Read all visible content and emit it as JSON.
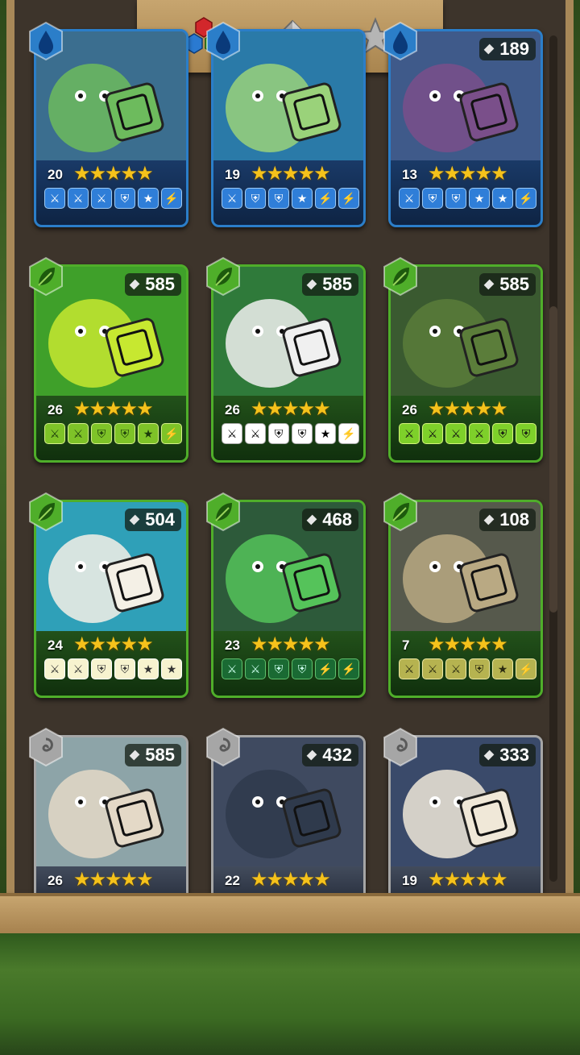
{
  "tabs": [
    {
      "name": "colors-tab",
      "icon": "colored-hexagons-icon",
      "active": true
    },
    {
      "name": "dice-tab",
      "icon": "gray-die-icon",
      "active": false
    },
    {
      "name": "star-tab",
      "icon": "star-icon",
      "active": false
    }
  ],
  "cards": [
    {
      "id": "snake-creature",
      "element": "water",
      "shards": "",
      "level": "20",
      "stars": "★★★★★",
      "faces": [
        "⚔",
        "⚔",
        "⚔",
        "⛨",
        "★",
        "⚡"
      ],
      "theme": "blue"
    },
    {
      "id": "owl-mage",
      "element": "water",
      "shards": "",
      "level": "19",
      "stars": "★★★★★",
      "faces": [
        "⚔",
        "⛨",
        "⛨",
        "★",
        "⚡",
        "⚡"
      ],
      "theme": "blue"
    },
    {
      "id": "medusa",
      "element": "water",
      "shards": "189",
      "level": "13",
      "stars": "★★★★★",
      "faces": [
        "⚔",
        "⛨",
        "⛨",
        "★",
        "★",
        "⚡"
      ],
      "theme": "blue"
    },
    {
      "id": "slime",
      "element": "nature",
      "shards": "585",
      "level": "26",
      "stars": "★★★★★",
      "faces": [
        "⚔",
        "⚔",
        "⛨",
        "⛨",
        "★",
        "⚡"
      ],
      "theme": "green"
    },
    {
      "id": "panda",
      "element": "nature",
      "shards": "585",
      "level": "26",
      "stars": "★★★★★",
      "faces": [
        "⚔",
        "⚔",
        "⛨",
        "⛨",
        "★",
        "⚡"
      ],
      "theme": "green panda"
    },
    {
      "id": "orc",
      "element": "nature",
      "shards": "585",
      "level": "26",
      "stars": "★★★★★",
      "faces": [
        "⚔",
        "⚔",
        "⚔",
        "⚔",
        "⛨",
        "⛨"
      ],
      "theme": "green orc"
    },
    {
      "id": "unicorn",
      "element": "nature",
      "shards": "504",
      "level": "24",
      "stars": "★★★★★",
      "faces": [
        "⚔",
        "⚔",
        "⛨",
        "⛨",
        "★",
        "★"
      ],
      "theme": "green unicorn"
    },
    {
      "id": "hydra",
      "element": "nature",
      "shards": "468",
      "level": "23",
      "stars": "★★★★★",
      "faces": [
        "⚔",
        "⚔",
        "⛨",
        "⛨",
        "⚡",
        "⚡"
      ],
      "theme": "green hydra"
    },
    {
      "id": "dwarf",
      "element": "nature",
      "shards": "108",
      "level": "7",
      "stars": "★★★★★",
      "faces": [
        "⚔",
        "⚔",
        "⚔",
        "⛨",
        "★",
        "⚡"
      ],
      "theme": "green dwarf"
    },
    {
      "id": "dryad",
      "element": "wind",
      "shards": "585",
      "level": "26",
      "stars": "★★★★★",
      "faces": [
        "⚔",
        "⚔",
        "⛨",
        "⛨",
        "⚡",
        "⚡"
      ],
      "theme": "gray elf"
    },
    {
      "id": "knight",
      "element": "wind",
      "shards": "432",
      "level": "22",
      "stars": "★★★★★",
      "faces": [
        "⚔",
        "⛨",
        "⛨",
        "⛨",
        "★",
        "★"
      ],
      "theme": "gray"
    },
    {
      "id": "wizard",
      "element": "wind",
      "shards": "333",
      "level": "19",
      "stars": "★★★★★",
      "faces": [
        "⚔",
        "⚔",
        "⛨",
        "⛨",
        "⚡",
        "⚡"
      ],
      "theme": "gray"
    }
  ],
  "colors": {
    "water": "#2b7ec9",
    "nature": "#4fae2a",
    "wind": "#a6a6a6",
    "star": "#f5c21b",
    "wood": "#b8945d"
  }
}
